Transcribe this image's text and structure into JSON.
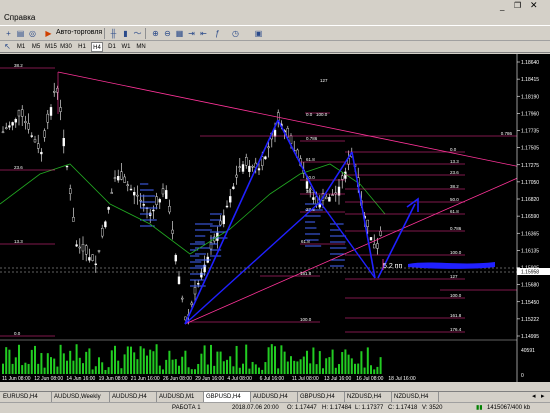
{
  "menu": {
    "label": "Справка"
  },
  "toolbar": {
    "autotrade_label": "Авто-торговля",
    "timeframes": [
      "M1",
      "M5",
      "M15",
      "M30",
      "H1",
      "H4",
      "D1",
      "W1",
      "MN"
    ],
    "active_timeframe": "H4"
  },
  "chart": {
    "price_labels": [
      "1.18640",
      "1.18415",
      "1.18190",
      "1.17960",
      "1.17735",
      "1.17505",
      "1.17275",
      "1.17050",
      "1.16820",
      "1.16590",
      "1.16365",
      "1.16135",
      "1.15905",
      "1.15680",
      "1.15450",
      "1.15222",
      "1.14995"
    ],
    "current_price_label": "1.15958",
    "indicator_value": "40591",
    "indicator_zero": "0",
    "date_labels": [
      "11 Jun 08:00",
      "12 Jun 08:00",
      "14 Jun 16:00",
      "19 Jun 08:00",
      "21 Jun 16:00",
      "26 Jun 08:00",
      "29 Jun 16:00",
      "4 Jul 08:00",
      "6 Jul 16:00",
      "11 Jul 08:00",
      "13 Jul 16:00",
      "16 Jul 08:00",
      "18 Jul 16:00"
    ],
    "fib_left": [
      "38.2",
      "23.6",
      "13.3",
      "0.0"
    ],
    "fib_mid_top": [
      "127",
      "0.0",
      "100.0"
    ],
    "fib_mid_levels": [
      "61.8",
      "50.0",
      "38.2",
      "23.6",
      "61.8",
      "0.786"
    ],
    "fib_right": [
      "0.786",
      "0.0",
      "13.3",
      "23.6",
      "38.2",
      "50.0",
      "61.8",
      "0.786",
      "100.0",
      "127",
      "100.0",
      "161.8",
      "176.4"
    ],
    "fib_small": [
      "100.0",
      "161.8"
    ],
    "annotation": "5.2 пп"
  },
  "tabs": [
    "EURUSD,H4",
    "AUDUSD,Weekly",
    "AUDUSD,H4",
    "AUDUSD,M1",
    "GBPUSD,H4",
    "AUDUSD,H4",
    "GBPUSD,H4",
    "NZDUSD,H4",
    "NZDUSD,H4"
  ],
  "active_tab": "GBPUSD,H4",
  "status": {
    "profile": "РАБОТА 1",
    "datetime": "2018.07.06 20:00",
    "open": "O: 1.17447",
    "high": "H: 1.17484",
    "low": "L: 1.17377",
    "close": "C: 1.17418",
    "volume": "V: 3520",
    "traffic": "1415067/400 kb"
  },
  "colors": {
    "bull_candle": "#ffffff",
    "bear_candle": "#000000",
    "pattern_line": "#2020ff",
    "fib_line": "#ff3399",
    "ma_line": "#22aa22",
    "volume_bar": "#22cc22"
  }
}
